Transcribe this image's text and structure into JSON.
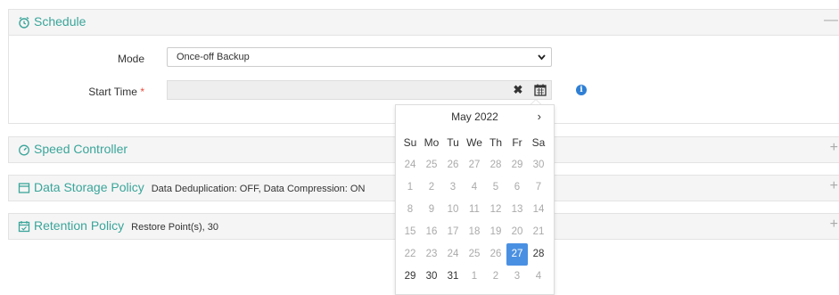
{
  "schedule": {
    "title": "Schedule",
    "toggle": "—",
    "mode_label": "Mode",
    "mode_value": "Once-off Backup",
    "start_time_label": "Start Time",
    "required_mark": "*",
    "start_time_value": "",
    "clear_glyph": "✖",
    "info_glyph": "i"
  },
  "speed": {
    "title": "Speed Controller",
    "toggle": "+"
  },
  "storage": {
    "title": "Data Storage Policy",
    "summary": "Data Deduplication: OFF, Data Compression: ON",
    "toggle": "+"
  },
  "retention": {
    "title": "Retention Policy",
    "summary": "Restore Point(s), 30",
    "toggle": "+"
  },
  "datepicker": {
    "month_label": "May 2022",
    "next_glyph": "›",
    "weekdays": [
      "Su",
      "Mo",
      "Tu",
      "We",
      "Th",
      "Fr",
      "Sa"
    ],
    "weeks": [
      [
        "24",
        "25",
        "26",
        "27",
        "28",
        "29",
        "30"
      ],
      [
        "1",
        "2",
        "3",
        "4",
        "5",
        "6",
        "7"
      ],
      [
        "8",
        "9",
        "10",
        "11",
        "12",
        "13",
        "14"
      ],
      [
        "15",
        "16",
        "17",
        "18",
        "19",
        "20",
        "21"
      ],
      [
        "22",
        "23",
        "24",
        "25",
        "26",
        "27",
        "28"
      ],
      [
        "29",
        "30",
        "31",
        "1",
        "2",
        "3",
        "4"
      ]
    ],
    "week_states": [
      [
        "past",
        "past",
        "past",
        "past",
        "past",
        "past",
        "past"
      ],
      [
        "past",
        "past",
        "past",
        "past",
        "past",
        "past",
        "past"
      ],
      [
        "past",
        "past",
        "past",
        "past",
        "past",
        "past",
        "past"
      ],
      [
        "past",
        "past",
        "past",
        "past",
        "past",
        "past",
        "past"
      ],
      [
        "past",
        "past",
        "past",
        "past",
        "past",
        "selected",
        "current"
      ],
      [
        "current",
        "current",
        "current",
        "muted",
        "muted",
        "muted",
        "muted"
      ]
    ],
    "selected_color": "#4a90e2"
  },
  "colors": {
    "accent": "#3aa59a",
    "info": "#2f7fd5",
    "required": "#e74c3c"
  }
}
